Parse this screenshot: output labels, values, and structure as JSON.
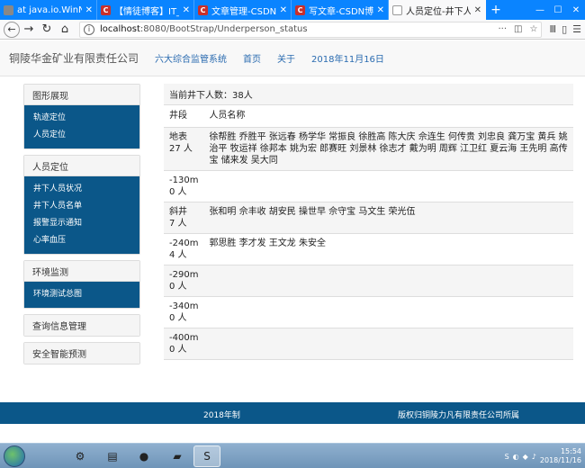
{
  "browser": {
    "tabs": [
      {
        "title": "at java.io.WinNTFil",
        "favicon": "gray",
        "active": false
      },
      {
        "title": "【情徒博客】IT_JAV",
        "favicon": "red",
        "active": false
      },
      {
        "title": "文章管理-CSDN博客",
        "favicon": "red",
        "active": false
      },
      {
        "title": "写文章-CSDN博客",
        "favicon": "red",
        "active": false
      },
      {
        "title": "人员定位-井下人员",
        "favicon": "doc",
        "active": true
      }
    ],
    "new_tab": "+",
    "url_host": "localhost",
    "url_rest": ":8080/BootStrap/Underperson_status",
    "url_info": "i",
    "url_more": "···",
    "url_star": "☆",
    "accent": "#0a84ff"
  },
  "site": {
    "brand": "铜陵华金矿业有限责任公司",
    "nav": [
      "六大综合监管系统",
      "首页",
      "关于",
      "2018年11月16日"
    ]
  },
  "sidebar": {
    "sections": [
      {
        "title": "图形展现",
        "items": [
          "轨迹定位",
          "人员定位"
        ]
      },
      {
        "title": "人员定位",
        "items": [
          "井下人员状况",
          "井下人员名单",
          "报警显示通知",
          "心率血压"
        ]
      },
      {
        "title": "环境监测",
        "items": [
          "环境测试总图"
        ]
      },
      {
        "title": "查询信息管理",
        "items": []
      },
      {
        "title": "安全智能预测",
        "items": []
      }
    ]
  },
  "main": {
    "count_label": "当前井下人数：38人",
    "headers": [
      "井段",
      "人员名称"
    ],
    "rows": [
      {
        "seg": "地表",
        "count": "27 人",
        "names": "徐帮胜 乔胜平 张远春 杨学华 常振良 徐胜高 陈大庆 佘连生 何传贵 刘忠良 龚万宝 黄兵 姚治平 牧运祥 徐邦本 姚为宏 郎赛旺 刘景林 徐志才 戴为明 周辉 江卫红 夏云海 王先明 高传宝 储来发 吴大同"
      },
      {
        "seg": "-130m",
        "count": "0 人",
        "names": ""
      },
      {
        "seg": "斜井",
        "count": "7 人",
        "names": "张和明 佘丰收 胡安民 操世早 佘守宝 马文生 荣光伍"
      },
      {
        "seg": "-240m",
        "count": "4 人",
        "names": "郭思胜 李才发 王文龙 朱安全"
      },
      {
        "seg": "-290m",
        "count": "0 人",
        "names": ""
      },
      {
        "seg": "-340m",
        "count": "0 人",
        "names": ""
      },
      {
        "seg": "-400m",
        "count": "0 人",
        "names": ""
      }
    ]
  },
  "footer": {
    "left": "2018年制",
    "right": "版权归铜陵力凡有限责任公司所属"
  },
  "taskbar": {
    "time": "15:54",
    "date": "2018/11/16"
  },
  "colors": {
    "sidebar_blue": "#0b5789",
    "link_blue": "#2a6bb0"
  }
}
